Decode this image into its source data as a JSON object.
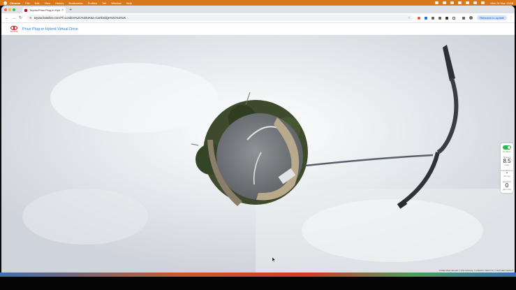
{
  "menubar": {
    "app_name": "Chrome",
    "items": [
      "File",
      "Edit",
      "View",
      "History",
      "Bookmarks",
      "Profiles",
      "Tab",
      "Window",
      "Help"
    ],
    "clock": "Mon 24 Nov 13:06"
  },
  "browser": {
    "tab": {
      "title": "Toyota Prius Plug-in Hybri",
      "close": "×"
    },
    "new_tab": "+",
    "url": "toyota.baseline.com/?f=London%2C%20UK&t=Cambridge%2C%20UK",
    "relaunch_label": "Relaunch to update",
    "colors": {
      "tab_strip": "#dee1e6",
      "relaunch_bg": "#d3e3fd"
    }
  },
  "site": {
    "logo_text": "TOYOTA",
    "title": "Prius Plug-in Hybrid Virtual Drive",
    "brand_color": "#c00000",
    "title_color": "#2a7fd1"
  },
  "hud": {
    "ev_mode_label": "EV Mode",
    "ev_mode_on": true,
    "distance_caption": "Distance",
    "distance_value": "8.5",
    "distance_unit": "miles",
    "fuel_caption": "Fuel Efficiency",
    "fuel_value": "•",
    "fuel_unit": "UK mpg",
    "emissions_caption": "Emissions",
    "emissions_value": "0",
    "emissions_unit": "g/km CO2"
  },
  "footer": {
    "copyright": "STREETVIEW IMAGES © 2023 GOOGLE, © ALBERTO VIZZOTTO, © MATTHEW WRIGHT"
  }
}
